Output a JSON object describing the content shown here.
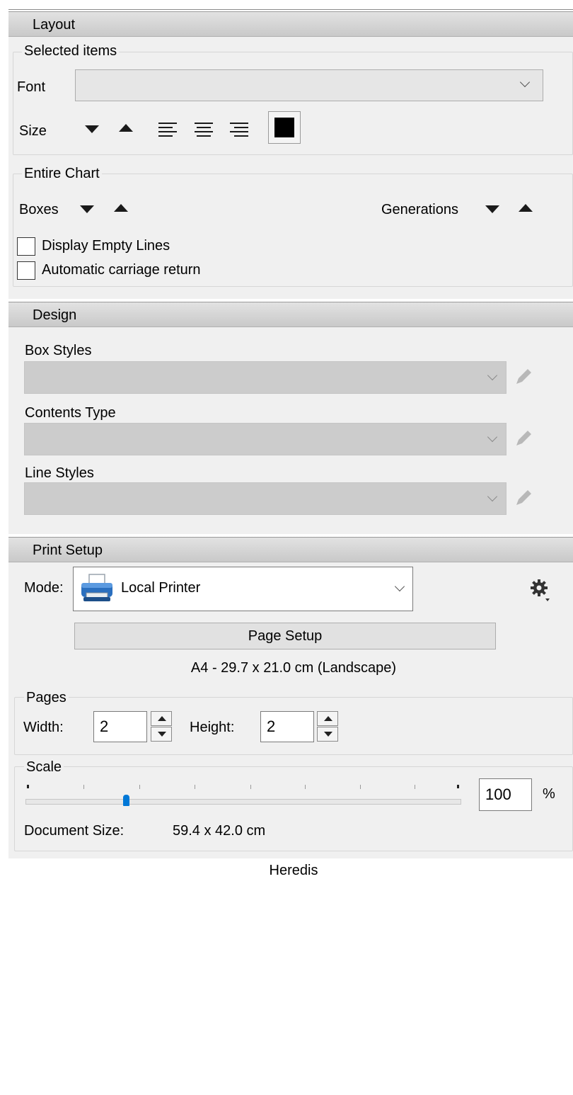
{
  "layout": {
    "header": "Layout",
    "selected_items": {
      "title": "Selected items",
      "font_label": "Font",
      "font_value": "",
      "size_label": "Size"
    },
    "entire_chart": {
      "title": "Entire Chart",
      "boxes_label": "Boxes",
      "generations_label": "Generations",
      "display_empty_lines": {
        "label": "Display Empty Lines",
        "checked": false
      },
      "automatic_carriage_return": {
        "label": "Automatic carriage return",
        "checked": false
      }
    },
    "text_color": "#000000"
  },
  "design": {
    "header": "Design",
    "box_styles_label": "Box Styles",
    "contents_type_label": "Contents Type",
    "line_styles_label": "Line Styles"
  },
  "print_setup": {
    "header": "Print Setup",
    "mode_label": "Mode:",
    "mode_value": "Local Printer",
    "page_setup_button": "Page Setup",
    "paper_info": "A4 - 29.7 x 21.0 cm (Landscape)",
    "pages": {
      "title": "Pages",
      "width_label": "Width:",
      "width_value": "2",
      "height_label": "Height:",
      "height_value": "2"
    },
    "scale": {
      "title": "Scale",
      "slider_level": 0.23,
      "value": "100",
      "unit": "%",
      "document_size_label": "Document Size:",
      "document_size_value": "59.4 x 42.0 cm"
    }
  },
  "footer": "Heredis",
  "colors": {
    "panel_bg": "#f0f0f0",
    "disabled_combo": "#cccccc",
    "slider_thumb": "#0078d7",
    "printer_icon": "#2a6fbf"
  }
}
